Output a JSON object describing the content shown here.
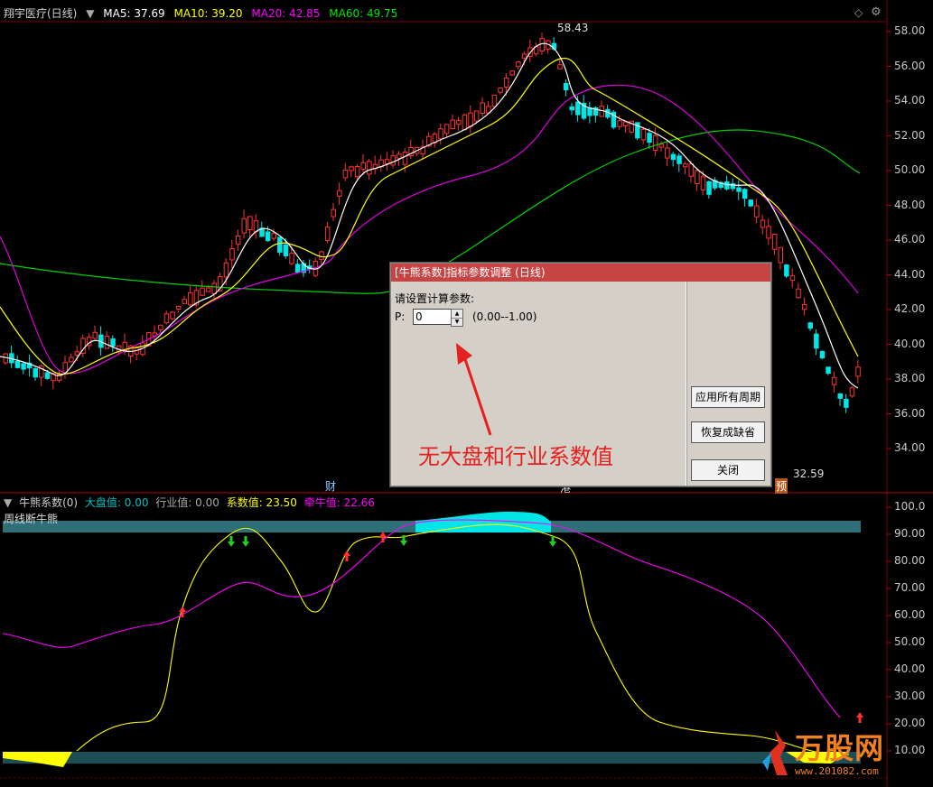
{
  "top_legend": {
    "title": "翔宇医疗(日线)",
    "ma5": "MA5: 37.69",
    "ma10": "MA10: 39.20",
    "ma20": "MA20: 42.85",
    "ma60": "MA60: 49.75"
  },
  "bottom_legend": {
    "title": "牛熊系数(0)",
    "dapan": "大盘值: 0.00",
    "hangye": "行业值: 0.00",
    "xishu": "系数值: 23.50",
    "qianniu": "牵牛值: 22.66",
    "subtitle": "周线断牛熊"
  },
  "price_axis": [
    "58.00",
    "56.00",
    "54.00",
    "52.00",
    "50.00",
    "48.00",
    "46.00",
    "44.00",
    "42.00",
    "40.00",
    "38.00",
    "36.00",
    "34.00"
  ],
  "indicator_axis": [
    "100.0",
    "90.00",
    "80.00",
    "70.00",
    "60.00",
    "50.00",
    "40.00",
    "30.00",
    "20.00",
    "10.00"
  ],
  "annotations": {
    "high": "58.43",
    "low": "32.59",
    "event_cai": "财",
    "event_yu": "预",
    "event_gang": "港"
  },
  "dialog": {
    "title": "[牛熊系数]指标参数调整 (日线)",
    "prompt": "请设置计算参数:",
    "param_label": "P:",
    "param_value": "0",
    "param_range": "(0.00--1.00)",
    "btn_apply": "应用所有周期",
    "btn_restore": "恢复成缺省",
    "btn_close": "关闭"
  },
  "callout": "无大盘和行业系数值",
  "watermark": {
    "brand": "万股网",
    "url": "www.201082.com"
  },
  "colors": {
    "up": "#ff3232",
    "down": "#00e6e6",
    "ma5": "#ffffff",
    "ma10": "#ffff00",
    "ma20": "#ff00ff",
    "ma60": "#00e600",
    "dialog_title": "#c64444"
  }
}
